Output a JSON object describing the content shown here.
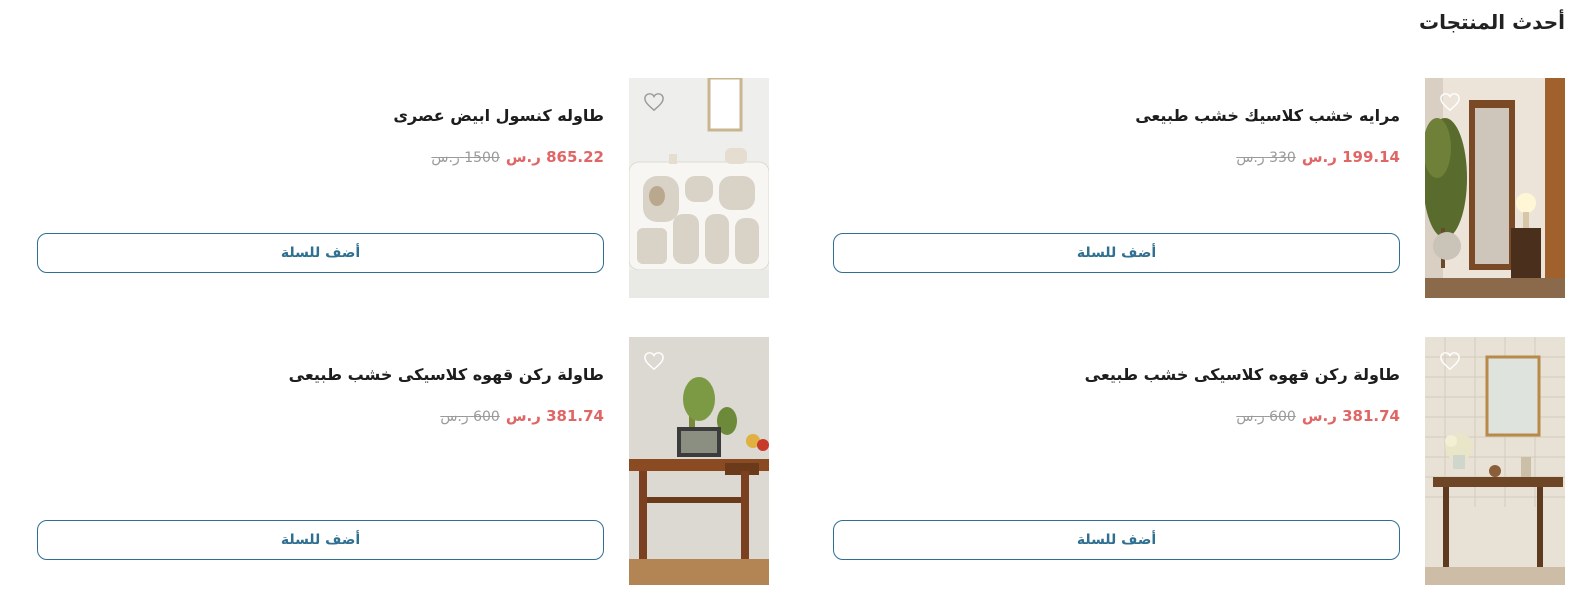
{
  "section": {
    "title": "أحدث المنتجات"
  },
  "products": [
    {
      "name": "مرايه خشب كلاسيك خشب طبيعى",
      "price": "199.14",
      "currency": "ر.س",
      "old_price": "330",
      "old_currency": "ر.س",
      "cart_label": "أضف للسلة",
      "image_icon": "mirror-bedroom-photo"
    },
    {
      "name": "طاوله كنسول ابيض عصرى",
      "price": "865.22",
      "currency": "ر.س",
      "old_price": "1500",
      "old_currency": "ر.س",
      "cart_label": "أضف للسلة",
      "image_icon": "white-console-photo"
    },
    {
      "name": "طاولة ركن قهوه كلاسيكى خشب طبيعى",
      "price": "381.74",
      "currency": "ر.س",
      "old_price": "600",
      "old_currency": "ر.س",
      "cart_label": "أضف للسلة",
      "image_icon": "stone-wall-table-photo"
    },
    {
      "name": "طاولة ركن قهوه كلاسيكى خشب طبيعى",
      "price": "381.74",
      "currency": "ر.س",
      "old_price": "600",
      "old_currency": "ر.س",
      "cart_label": "أضف للسلة",
      "image_icon": "wood-table-plant-photo"
    }
  ],
  "colors": {
    "price": "#e06666",
    "old_price": "#9a9a9a",
    "button": "#2f6f91"
  }
}
